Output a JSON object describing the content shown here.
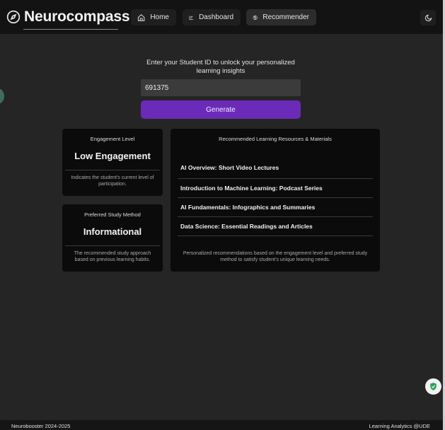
{
  "nav": {
    "brand": "Neurocompass",
    "home_label": "Home",
    "dashboard_label": "Dashboard",
    "recommender_label": "Recommender",
    "brand_icon": "compass-icon",
    "theme_icon": "moon-icon"
  },
  "search": {
    "prompt": "Enter your Student ID to unlock your personalized learning insights",
    "student_id": "691375",
    "generate_label": "Generate"
  },
  "engagement": {
    "label": "Engagement Level",
    "value": "Low Engagement",
    "description": "Indicates the student's current level of participation."
  },
  "study_method": {
    "label": "Preferred Study Method",
    "value": "Informational",
    "description": "The recommended study approach based on previous learning habits."
  },
  "resources": {
    "title": "Recommended Learning Resources & Materials",
    "items": [
      "AI Overview: Short Video Lectures",
      "Introduction to Machine Learning: Podcast Series",
      "AI Fundamentals: Infographics and Summaries",
      "Data Science: Essential Readings and Articles"
    ],
    "footer": "Personalized recommendations based on the engagement level and preferred study method to satisfy student's unique learning needs."
  },
  "footer": {
    "left": "Neurobooster 2024-2025",
    "right": "Learning Analytics @UDE"
  },
  "colors": {
    "accent": "#6b2bb8",
    "background": "#252525",
    "card": "#0b0b0b",
    "navbar": "#131313"
  }
}
